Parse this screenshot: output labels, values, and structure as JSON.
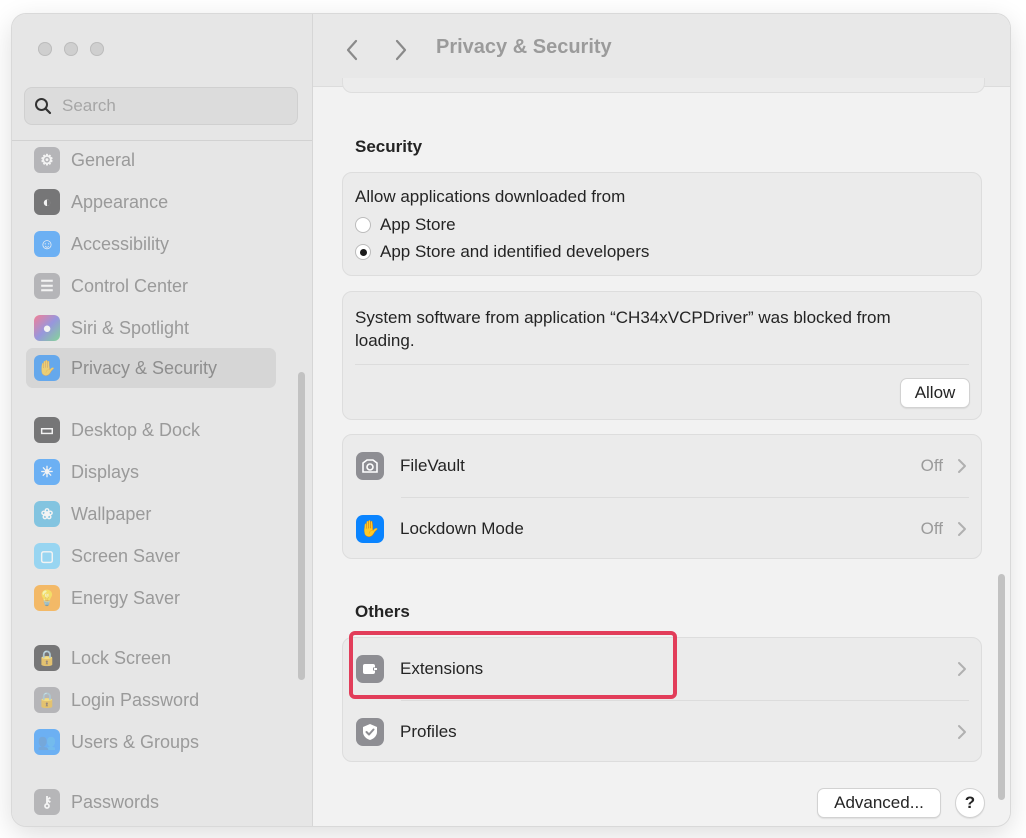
{
  "sidebar": {
    "search_placeholder": "Search",
    "items": [
      {
        "label": "General",
        "icon": "gear-icon",
        "color": "#8e8e93"
      },
      {
        "label": "Appearance",
        "icon": "appearance-icon",
        "color": "#1c1c1e"
      },
      {
        "label": "Accessibility",
        "icon": "accessibility-icon",
        "color": "#0a84ff"
      },
      {
        "label": "Control Center",
        "icon": "control-center-icon",
        "color": "#8e8e93"
      },
      {
        "label": "Siri & Spotlight",
        "icon": "siri-icon",
        "color": "#8e44ad"
      },
      {
        "label": "Privacy & Security",
        "icon": "privacy-hand-icon",
        "color": "#0a84ff"
      },
      {
        "label": "Desktop & Dock",
        "icon": "desktop-dock-icon",
        "color": "#1c1c1e"
      },
      {
        "label": "Displays",
        "icon": "displays-icon",
        "color": "#0a84ff"
      },
      {
        "label": "Wallpaper",
        "icon": "wallpaper-icon",
        "color": "#34aadc"
      },
      {
        "label": "Screen Saver",
        "icon": "screen-saver-icon",
        "color": "#5ac8fa"
      },
      {
        "label": "Energy Saver",
        "icon": "energy-saver-icon",
        "color": "#ff9500"
      },
      {
        "label": "Lock Screen",
        "icon": "lock-icon",
        "color": "#1c1c1e"
      },
      {
        "label": "Login Password",
        "icon": "login-password-icon",
        "color": "#8e8e93"
      },
      {
        "label": "Users & Groups",
        "icon": "users-groups-icon",
        "color": "#0a84ff"
      },
      {
        "label": "Passwords",
        "icon": "key-icon",
        "color": "#8e8e93"
      }
    ]
  },
  "toolbar": {
    "title": "Privacy & Security"
  },
  "security": {
    "section_title": "Security",
    "allow_label": "Allow applications downloaded from",
    "option_app_store": "App Store",
    "option_identified": "App Store and identified developers",
    "blocked_message": "System software from application “CH34xVCPDriver” was blocked from loading.",
    "allow_button": "Allow",
    "filevault_label": "FileVault",
    "filevault_value": "Off",
    "lockdown_label": "Lockdown Mode",
    "lockdown_value": "Off"
  },
  "others": {
    "section_title": "Others",
    "extensions_label": "Extensions",
    "profiles_label": "Profiles"
  },
  "footer": {
    "advanced_button": "Advanced...",
    "help_button": "?"
  },
  "colors": {
    "highlight": "#e23d5a",
    "accent": "#0a84ff"
  }
}
